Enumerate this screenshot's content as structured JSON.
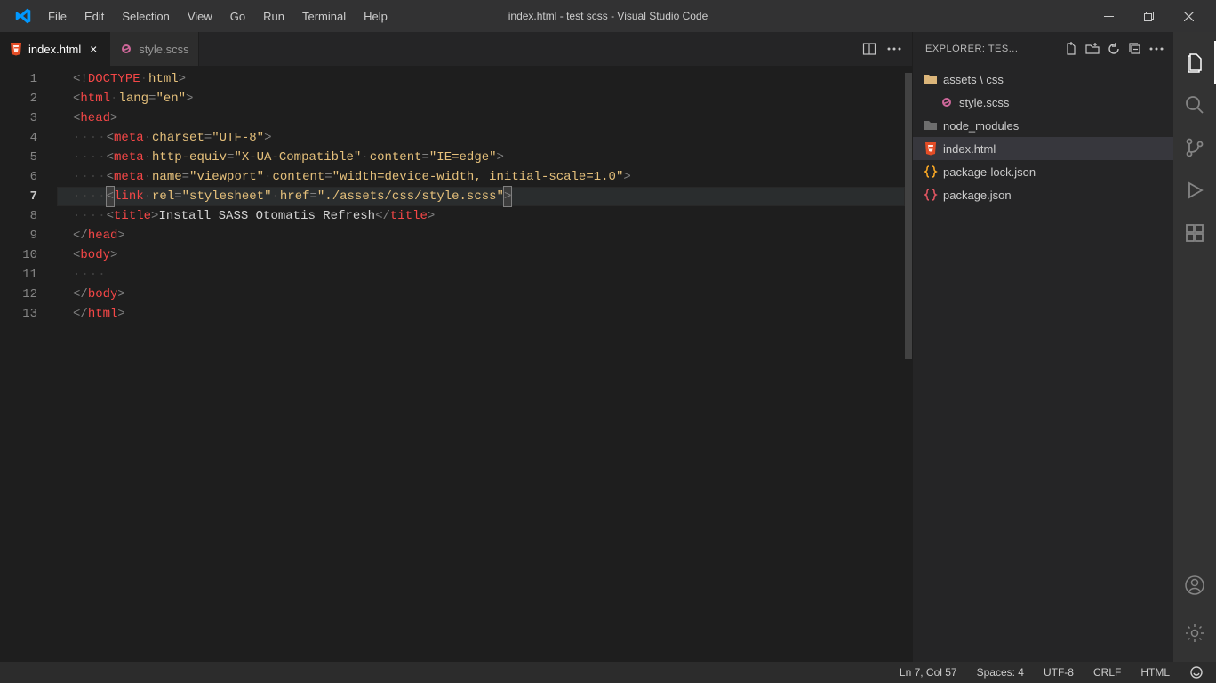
{
  "menu": [
    "File",
    "Edit",
    "Selection",
    "View",
    "Go",
    "Run",
    "Terminal",
    "Help"
  ],
  "window_title": "index.html - test scss - Visual Studio Code",
  "tabs": [
    {
      "name": "index.html",
      "active": true,
      "icon": "html"
    },
    {
      "name": "style.scss",
      "active": false,
      "icon": "sass"
    }
  ],
  "code": {
    "lines": [
      {
        "n": 1,
        "html": "<span class='tok-p'>&lt;!</span><span class='tok-doctype'>DOCTYPE</span><span class='tok-dots'>&middot;</span><span class='tok-html-id'>html</span><span class='tok-p'>&gt;</span>"
      },
      {
        "n": 2,
        "html": "<span class='tok-p'>&lt;</span><span class='tok-tag'>html</span><span class='tok-dots'>&middot;</span><span class='tok-attr'>lang</span><span class='tok-p'>=</span><span class='tok-str'>\"en\"</span><span class='tok-p'>&gt;</span>"
      },
      {
        "n": 3,
        "html": "<span class='tok-p'>&lt;</span><span class='tok-tag'>head</span><span class='tok-p'>&gt;</span>"
      },
      {
        "n": 4,
        "html": "<span class='tok-dots'>&middot;&middot;&middot;&middot;</span><span class='tok-p'>&lt;</span><span class='tok-tag'>meta</span><span class='tok-dots'>&middot;</span><span class='tok-attr'>charset</span><span class='tok-p'>=</span><span class='tok-str'>\"UTF-8\"</span><span class='tok-p'>&gt;</span>"
      },
      {
        "n": 5,
        "html": "<span class='tok-dots'>&middot;&middot;&middot;&middot;</span><span class='tok-p'>&lt;</span><span class='tok-tag'>meta</span><span class='tok-dots'>&middot;</span><span class='tok-attr'>http-equiv</span><span class='tok-p'>=</span><span class='tok-str'>\"X-UA-Compatible\"</span><span class='tok-dots'>&middot;</span><span class='tok-attr'>content</span><span class='tok-p'>=</span><span class='tok-str'>\"IE=edge\"</span><span class='tok-p'>&gt;</span>"
      },
      {
        "n": 6,
        "html": "<span class='tok-dots'>&middot;&middot;&middot;&middot;</span><span class='tok-p'>&lt;</span><span class='tok-tag'>meta</span><span class='tok-dots'>&middot;</span><span class='tok-attr'>name</span><span class='tok-p'>=</span><span class='tok-str'>\"viewport\"</span><span class='tok-dots'>&middot;</span><span class='tok-attr'>content</span><span class='tok-p'>=</span><span class='tok-str'>\"width=device-width, initial-scale=1.0\"</span><span class='tok-p'>&gt;</span>"
      },
      {
        "n": 7,
        "highlight": true,
        "html": "<span class='tok-dots'>&middot;&middot;&middot;&middot;</span><span class='cursor-box'><span class='tok-p'>&lt;</span></span><span class='tok-tag'>link</span><span class='tok-dots'>&middot;</span><span class='tok-attr'>rel</span><span class='tok-p'>=</span><span class='tok-str'>\"stylesheet\"</span><span class='tok-dots'>&middot;</span><span class='tok-attr'>href</span><span class='tok-p'>=</span><span class='tok-str'>\"./assets/css/style.scss\"</span><span class='cursor-box'><span class='tok-p'>&gt;</span></span>"
      },
      {
        "n": 8,
        "html": "<span class='tok-dots'>&middot;&middot;&middot;&middot;</span><span class='tok-p'>&lt;</span><span class='tok-tag'>title</span><span class='tok-p'>&gt;</span><span class='tok-text'>Install SASS Otomatis Refresh</span><span class='tok-p'>&lt;/</span><span class='tok-tag'>title</span><span class='tok-p'>&gt;</span>"
      },
      {
        "n": 9,
        "html": "<span class='tok-p'>&lt;/</span><span class='tok-tag'>head</span><span class='tok-p'>&gt;</span>"
      },
      {
        "n": 10,
        "html": "<span class='tok-p'>&lt;</span><span class='tok-tag'>body</span><span class='tok-p'>&gt;</span>"
      },
      {
        "n": 11,
        "html": "<span class='tok-dots'>&middot;&middot;&middot;&middot;</span>"
      },
      {
        "n": 12,
        "html": "<span class='tok-p'>&lt;/</span><span class='tok-tag'>body</span><span class='tok-p'>&gt;</span>"
      },
      {
        "n": 13,
        "html": "<span class='tok-p'>&lt;/</span><span class='tok-tag'>html</span><span class='tok-p'>&gt;</span>"
      }
    ]
  },
  "explorer": {
    "title": "EXPLORER: TES...",
    "items": [
      {
        "label": "assets \\ css",
        "icon": "folder",
        "indent": false
      },
      {
        "label": "style.scss",
        "icon": "sass",
        "indent": true
      },
      {
        "label": "node_modules",
        "icon": "folder-gray",
        "indent": false
      },
      {
        "label": "index.html",
        "icon": "html",
        "indent": false,
        "active": true
      },
      {
        "label": "package-lock.json",
        "icon": "json",
        "indent": false
      },
      {
        "label": "package.json",
        "icon": "json-red",
        "indent": false
      }
    ]
  },
  "status": {
    "position": "Ln 7, Col 57",
    "spaces": "Spaces: 4",
    "encoding": "UTF-8",
    "eol": "CRLF",
    "language": "HTML"
  }
}
